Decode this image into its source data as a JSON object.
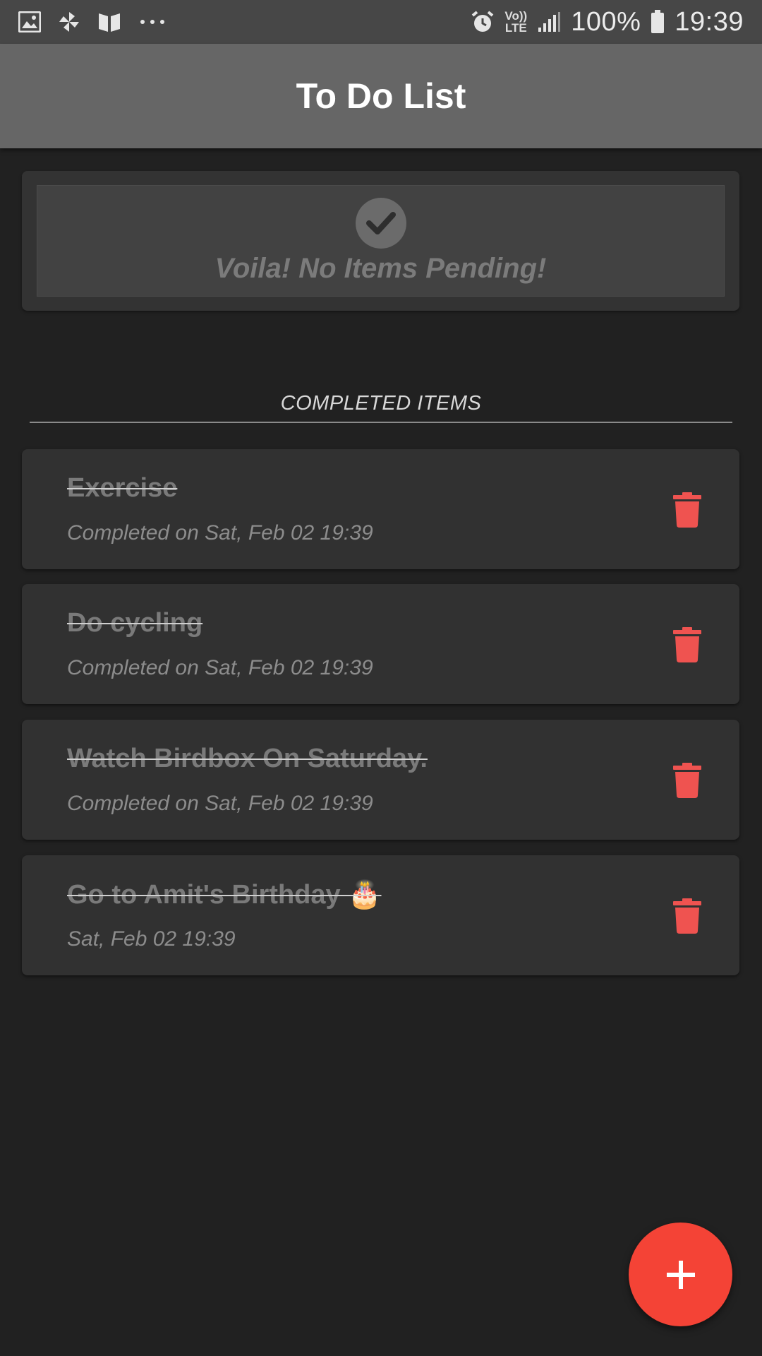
{
  "status_bar": {
    "icons_left": [
      "image-icon",
      "pinwheel-icon",
      "book-icon",
      "more-dots-icon"
    ],
    "network_top": "Vo))",
    "network_bottom": "LTE",
    "battery_percent": "100%",
    "time": "19:39"
  },
  "app_bar": {
    "title": "To Do List"
  },
  "pending": {
    "empty_message": "Voila! No Items Pending!"
  },
  "completed_section": {
    "title": "COMPLETED ITEMS",
    "items": [
      {
        "title": "Exercise",
        "subtitle": "Completed on Sat, Feb 02 19:39"
      },
      {
        "title": "Do cycling",
        "subtitle": "Completed on Sat, Feb 02 19:39"
      },
      {
        "title": "Watch Birdbox On Saturday.",
        "subtitle": "Completed on Sat, Feb 02 19:39"
      },
      {
        "title": "Go to Amit's Birthday 🎂",
        "subtitle": "Sat, Feb 02 19:39"
      }
    ]
  },
  "fab": {
    "label": "+"
  },
  "colors": {
    "accent": "#f44336",
    "delete": "#ef5350",
    "app_bar": "#666666",
    "background": "#212121"
  }
}
